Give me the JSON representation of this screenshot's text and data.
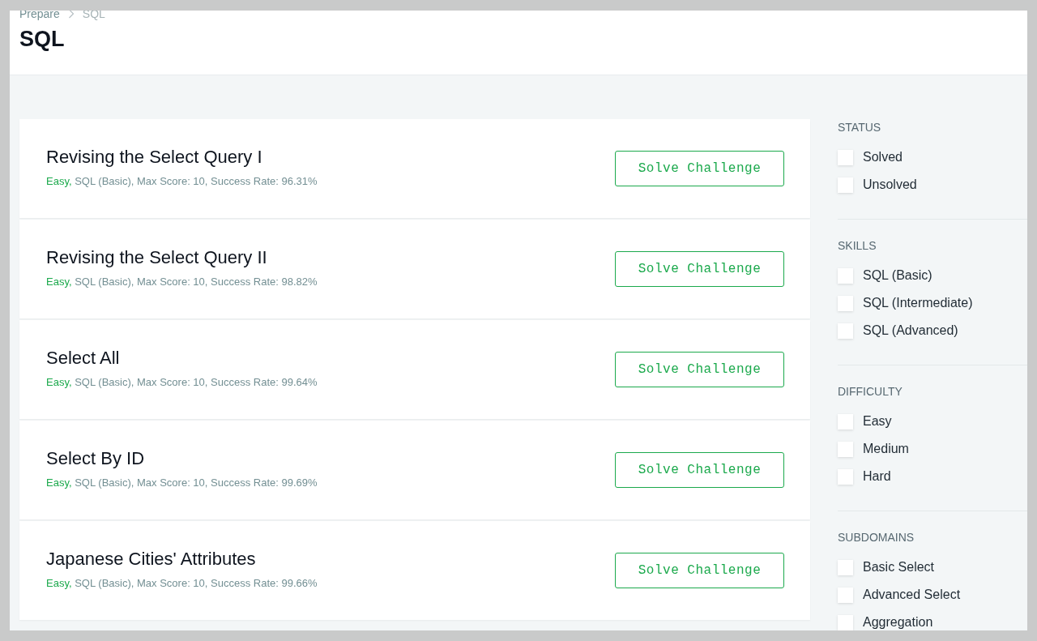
{
  "breadcrumb": [
    {
      "label": "Prepare"
    },
    {
      "label": "SQL"
    }
  ],
  "page_title": "SQL",
  "challenges": [
    {
      "title": "Revising the Select Query I",
      "difficulty": "Easy,",
      "details": "SQL (Basic), Max Score: 10, Success Rate: 96.31%",
      "button": "Solve Challenge"
    },
    {
      "title": "Revising the Select Query II",
      "difficulty": "Easy,",
      "details": "SQL (Basic), Max Score: 10, Success Rate: 98.82%",
      "button": "Solve Challenge"
    },
    {
      "title": "Select All",
      "difficulty": "Easy,",
      "details": "SQL (Basic), Max Score: 10, Success Rate: 99.64%",
      "button": "Solve Challenge"
    },
    {
      "title": "Select By ID",
      "difficulty": "Easy,",
      "details": "SQL (Basic), Max Score: 10, Success Rate: 99.69%",
      "button": "Solve Challenge"
    },
    {
      "title": "Japanese Cities' Attributes",
      "difficulty": "Easy,",
      "details": "SQL (Basic), Max Score: 10, Success Rate: 99.66%",
      "button": "Solve Challenge"
    }
  ],
  "filters": [
    {
      "heading": "STATUS",
      "options": [
        {
          "label": "Solved",
          "checked": false
        },
        {
          "label": "Unsolved",
          "checked": false
        }
      ]
    },
    {
      "heading": "SKILLS",
      "options": [
        {
          "label": "SQL (Basic)",
          "checked": false
        },
        {
          "label": "SQL (Intermediate)",
          "checked": false
        },
        {
          "label": "SQL (Advanced)",
          "checked": false
        }
      ]
    },
    {
      "heading": "DIFFICULTY",
      "options": [
        {
          "label": "Easy",
          "checked": false
        },
        {
          "label": "Medium",
          "checked": false
        },
        {
          "label": "Hard",
          "checked": false
        }
      ]
    },
    {
      "heading": "SUBDOMAINS",
      "options": [
        {
          "label": "Basic Select",
          "checked": false
        },
        {
          "label": "Advanced Select",
          "checked": false
        },
        {
          "label": "Aggregation",
          "checked": false
        }
      ]
    }
  ]
}
